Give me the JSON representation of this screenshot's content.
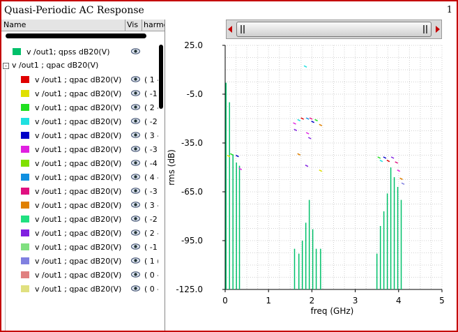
{
  "window": {
    "title": "Quasi-Periodic AC Response",
    "page_number": "1"
  },
  "panel": {
    "columns": [
      "Name",
      "Vis",
      "harmo"
    ],
    "items": [
      {
        "label": "v /out1; qpss dB20(V)",
        "color": "#00c06a",
        "harm": ""
      },
      {
        "label": "v /out1 ; qpac dB20(V)",
        "color": "",
        "harm": ""
      },
      {
        "label": "v /out1 ; qpac dB20(V)",
        "color": "#e00000",
        "harm": "( 1 -"
      },
      {
        "label": "v /out1 ; qpac dB20(V)",
        "color": "#e0e000",
        "harm": "( -1"
      },
      {
        "label": "v /out1 ; qpac dB20(V)",
        "color": "#20e020",
        "harm": "( 2 -"
      },
      {
        "label": "v /out1 ; qpac dB20(V)",
        "color": "#20e0e0",
        "harm": "( -2"
      },
      {
        "label": "v /out1 ; qpac dB20(V)",
        "color": "#0000c8",
        "harm": "( 3 -"
      },
      {
        "label": "v /out1 ; qpac dB20(V)",
        "color": "#e020e0",
        "harm": "( -3"
      },
      {
        "label": "v /out1 ; qpac dB20(V)",
        "color": "#80e000",
        "harm": "( -4"
      },
      {
        "label": "v /out1 ; qpac dB20(V)",
        "color": "#1090e0",
        "harm": "( 4 -"
      },
      {
        "label": "v /out1 ; qpac dB20(V)",
        "color": "#e01080",
        "harm": "( -3"
      },
      {
        "label": "v /out1 ; qpac dB20(V)",
        "color": "#e08000",
        "harm": "( 3 -"
      },
      {
        "label": "v /out1 ; qpac dB20(V)",
        "color": "#20e080",
        "harm": "( -2"
      },
      {
        "label": "v /out1 ; qpac dB20(V)",
        "color": "#8020e0",
        "harm": "( 2 -"
      },
      {
        "label": "v /out1 ; qpac dB20(V)",
        "color": "#80e080",
        "harm": "( -1"
      },
      {
        "label": "v /out1 ; qpac dB20(V)",
        "color": "#8080e0",
        "harm": "( 1 ("
      },
      {
        "label": "v /out1 ; qpac dB20(V)",
        "color": "#e08080",
        "harm": "( 0 -"
      },
      {
        "label": "v /out1 ; qpac dB20(V)",
        "color": "#e0e080",
        "harm": "( 0 -"
      }
    ]
  },
  "chart_data": {
    "type": "bar",
    "xlabel": "freq (GHz)",
    "ylabel": "rms (dB)",
    "xlim": [
      0,
      5
    ],
    "ylim": [
      -125,
      25
    ],
    "xticks": [
      "0",
      "1",
      "2",
      "3",
      "4",
      "5"
    ],
    "yticks": [
      "25.0",
      "-5.0",
      "-35.0",
      "-65.0",
      "-95.0",
      "-125.0"
    ],
    "grid": true,
    "series": [
      {
        "color": "#00c06a",
        "x": [
          0.02,
          0.1,
          0.18,
          0.26,
          0.33,
          1.6,
          1.7,
          1.78,
          1.86,
          1.94,
          2.02,
          2.1,
          2.2,
          3.5,
          3.58,
          3.66,
          3.74,
          3.82,
          3.9,
          3.98,
          4.06
        ],
        "values": [
          2,
          -10,
          -42,
          -47,
          -49,
          -100,
          -103,
          -95,
          -84,
          -70,
          -88,
          -100,
          -100,
          -103,
          -86,
          -77,
          -66,
          -50,
          -56,
          -62,
          -70
        ]
      }
    ],
    "markers": [
      {
        "x": 1.85,
        "y": 12,
        "color": "#20e0e0"
      },
      {
        "x": 0.08,
        "y": -43,
        "color": "#e0e000"
      },
      {
        "x": 0.15,
        "y": -42,
        "color": "#20e020"
      },
      {
        "x": 0.28,
        "y": -43,
        "color": "#0000c8"
      },
      {
        "x": 0.35,
        "y": -51,
        "color": "#e020e0"
      },
      {
        "x": 1.6,
        "y": -23,
        "color": "#e020e0"
      },
      {
        "x": 1.62,
        "y": -27,
        "color": "#8020e0"
      },
      {
        "x": 1.7,
        "y": -21,
        "color": "#20e0e0"
      },
      {
        "x": 1.78,
        "y": -20,
        "color": "#e00000"
      },
      {
        "x": 1.9,
        "y": -20,
        "color": "#1090e0"
      },
      {
        "x": 1.9,
        "y": -29,
        "color": "#e020e0"
      },
      {
        "x": 1.95,
        "y": -32,
        "color": "#8020e0"
      },
      {
        "x": 1.98,
        "y": -20,
        "color": "#e01080"
      },
      {
        "x": 2.02,
        "y": -22,
        "color": "#0000c8"
      },
      {
        "x": 2.1,
        "y": -21,
        "color": "#20e020"
      },
      {
        "x": 2.2,
        "y": -24,
        "color": "#e08000"
      },
      {
        "x": 1.7,
        "y": -42,
        "color": "#e08000"
      },
      {
        "x": 1.88,
        "y": -49,
        "color": "#8020e0"
      },
      {
        "x": 2.2,
        "y": -52,
        "color": "#e0e000"
      },
      {
        "x": 3.55,
        "y": -44,
        "color": "#20e020"
      },
      {
        "x": 3.6,
        "y": -46,
        "color": "#20e0e0"
      },
      {
        "x": 3.68,
        "y": -44,
        "color": "#0000c8"
      },
      {
        "x": 3.76,
        "y": -46,
        "color": "#e00000"
      },
      {
        "x": 3.86,
        "y": -44,
        "color": "#8020e0"
      },
      {
        "x": 3.95,
        "y": -47,
        "color": "#e01080"
      },
      {
        "x": 4.0,
        "y": -52,
        "color": "#e020e0"
      },
      {
        "x": 4.06,
        "y": -57,
        "color": "#e08000"
      },
      {
        "x": 4.1,
        "y": -60,
        "color": "#8080e0"
      }
    ]
  }
}
